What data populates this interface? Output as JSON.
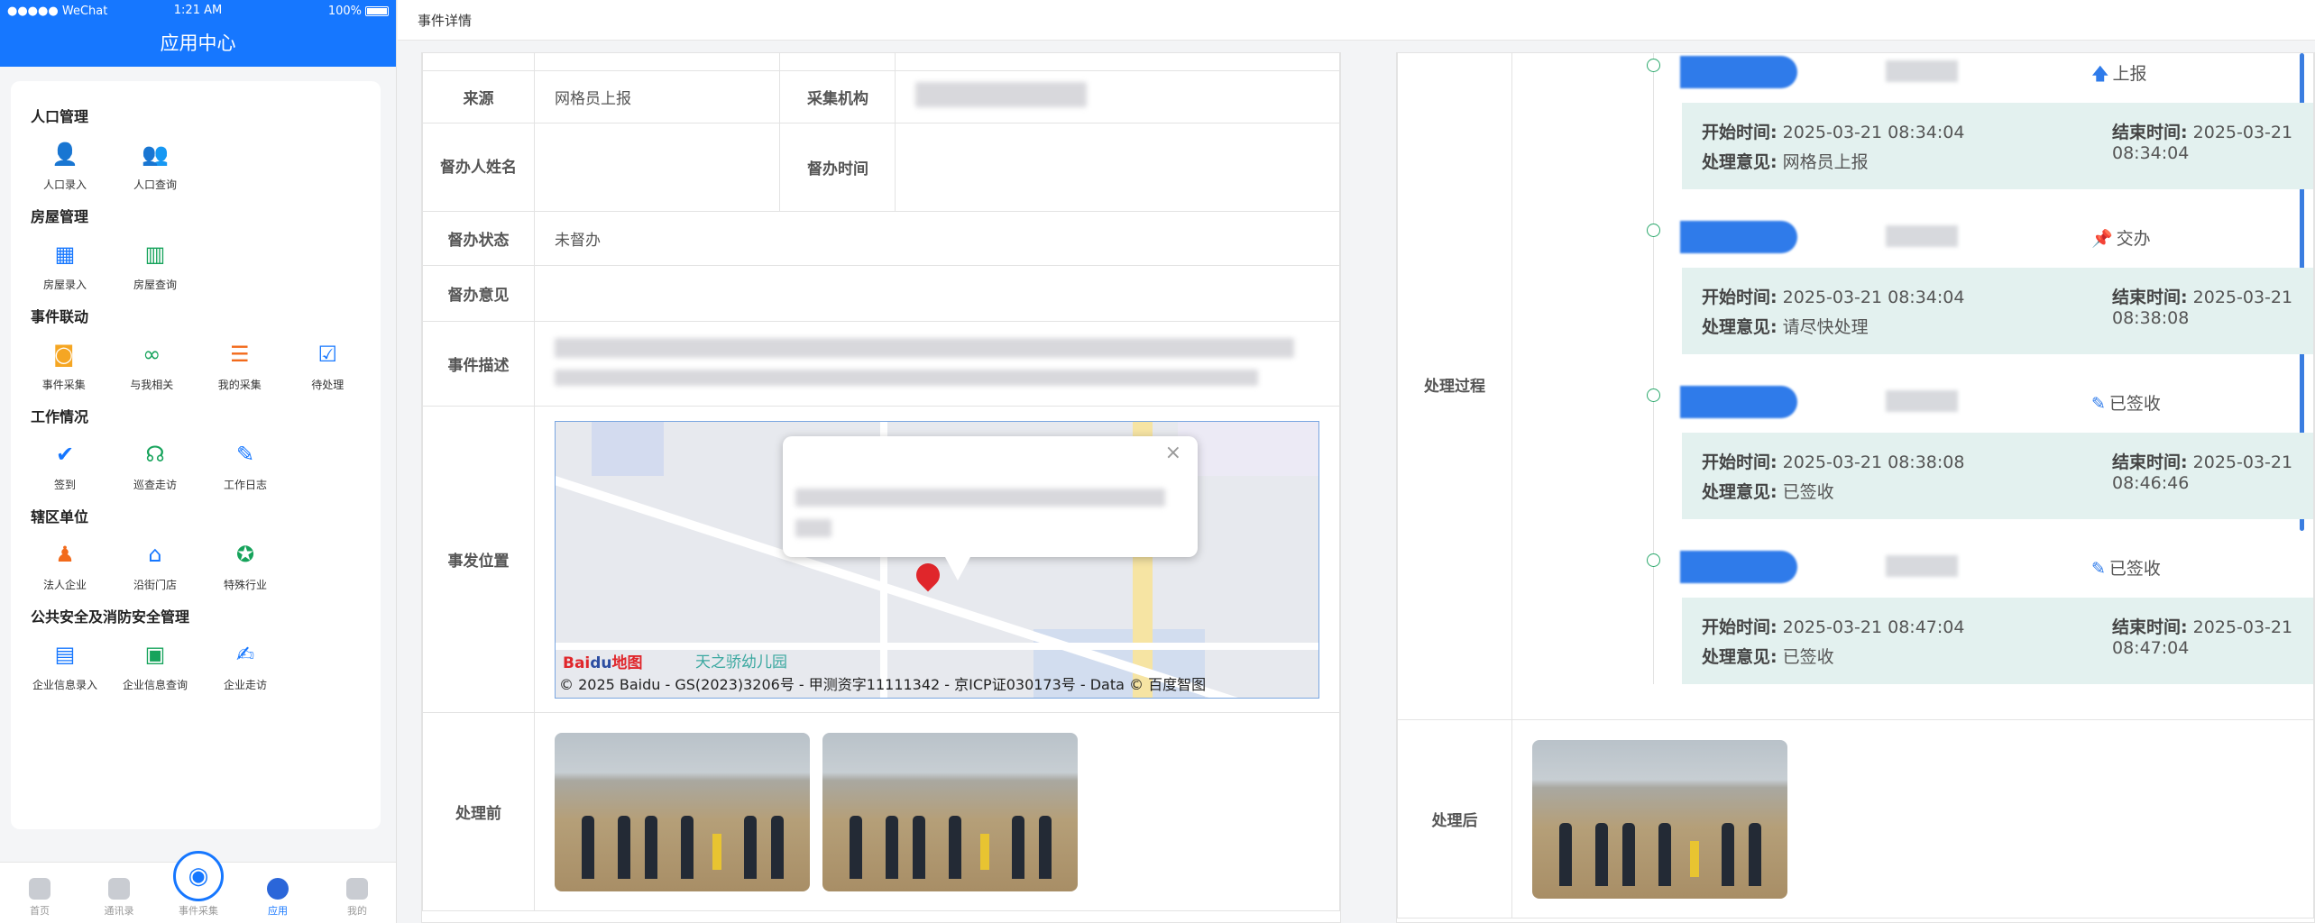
{
  "phone": {
    "status": {
      "carrier": "●●●●● WeChat",
      "time": "1:21 AM",
      "battery": "100%"
    },
    "title": "应用中心",
    "sections": [
      {
        "title": "人口管理",
        "items": [
          {
            "label": "人口录入",
            "icon": "person-add-icon",
            "color": "#1677ff"
          },
          {
            "label": "人口查询",
            "icon": "people-icon",
            "color": "#f26a1b"
          }
        ]
      },
      {
        "title": "房屋管理",
        "items": [
          {
            "label": "房屋录入",
            "icon": "building-add-icon",
            "color": "#1677ff"
          },
          {
            "label": "房屋查询",
            "icon": "building-icon",
            "color": "#16a35b"
          }
        ]
      },
      {
        "title": "事件联动",
        "items": [
          {
            "label": "事件采集",
            "icon": "camera-icon",
            "color": "#f5a623"
          },
          {
            "label": "与我相关",
            "icon": "link-icon",
            "color": "#16a35b"
          },
          {
            "label": "我的采集",
            "icon": "list-icon",
            "color": "#f26a1b"
          },
          {
            "label": "待处理",
            "icon": "task-icon",
            "color": "#1677ff"
          }
        ]
      },
      {
        "title": "工作情况",
        "items": [
          {
            "label": "签到",
            "icon": "calendar-check-icon",
            "color": "#1677ff"
          },
          {
            "label": "巡查走访",
            "icon": "patrol-icon",
            "color": "#16a35b"
          },
          {
            "label": "工作日志",
            "icon": "notebook-icon",
            "color": "#1677ff"
          }
        ]
      },
      {
        "title": "辖区单位",
        "items": [
          {
            "label": "法人企业",
            "icon": "legal-person-icon",
            "color": "#f26a1b"
          },
          {
            "label": "沿街门店",
            "icon": "storefront-icon",
            "color": "#1677ff"
          },
          {
            "label": "特殊行业",
            "icon": "badge-check-icon",
            "color": "#16a35b"
          }
        ]
      },
      {
        "title": "公共安全及消防安全管理",
        "items": [
          {
            "label": "企业信息录入",
            "icon": "enterprise-icon",
            "color": "#1677ff"
          },
          {
            "label": "企业信息查询",
            "icon": "briefcase-icon",
            "color": "#16a35b"
          },
          {
            "label": "企业走访",
            "icon": "document-edit-icon",
            "color": "#1677ff"
          }
        ]
      }
    ],
    "tabs": [
      "首页",
      "通讯录",
      "事件采集",
      "应用",
      "我的"
    ]
  },
  "topbar": {
    "title": "事件详情"
  },
  "detail": {
    "source_label": "来源",
    "source_value": "网格员上报",
    "org_label": "采集机构",
    "supervisor_label": "督办人姓名",
    "supervise_time_label": "督办时间",
    "supervise_status_label": "督办状态",
    "supervise_status_value": "未督办",
    "supervise_opinion_label": "督办意见",
    "description_label": "事件描述",
    "location_label": "事发位置",
    "before_label": "处理前"
  },
  "map": {
    "copyright": "© 2025 Baidu - GS(2023)3206号 - 甲测资字11111342 - 京ICP证030173号 - Data © 百度智图",
    "logo_a": "Bai",
    "logo_b": "du",
    "logo_c": "地图",
    "poi": "天之骄幼儿园",
    "close": "×"
  },
  "process": {
    "label": "处理过程",
    "after_label": "处理后",
    "start_label": "开始时间:",
    "end_label": "结束时间:",
    "opinion_label": "处理意见:",
    "steps": [
      {
        "action": "上报",
        "icon": "arrow-up-icon",
        "start": "2025-03-21 08:34:04",
        "end": "2025-03-21 08:34:04",
        "opinion": "网格员上报"
      },
      {
        "action": "交办",
        "icon": "pin-icon",
        "start": "2025-03-21 08:34:04",
        "end": "2025-03-21 08:38:08",
        "opinion": "请尽快处理"
      },
      {
        "action": "已签收",
        "icon": "pencil-icon",
        "start": "2025-03-21 08:38:08",
        "end": "2025-03-21 08:46:46",
        "opinion": "已签收"
      },
      {
        "action": "已签收",
        "icon": "pencil-icon",
        "start": "2025-03-21 08:47:04",
        "end": "2025-03-21 08:47:04",
        "opinion": "已签收"
      }
    ]
  }
}
